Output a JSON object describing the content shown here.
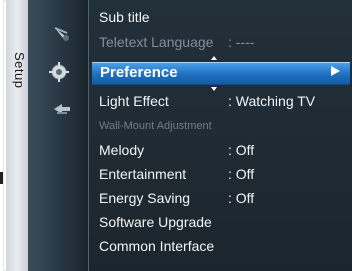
{
  "sidebar": {
    "category_label": "Setup",
    "icons": [
      "antenna-icon",
      "gear-icon",
      "input-icon"
    ]
  },
  "menu": {
    "items": [
      {
        "label": "Sub title",
        "value": ""
      },
      {
        "label": "Teletext Language",
        "value": ": ----"
      },
      {
        "label": "Preference",
        "value": ""
      },
      {
        "label": "Light Effect",
        "value": ": Watching TV"
      },
      {
        "label": "Wall-Mount Adjustment",
        "value": ""
      },
      {
        "label": "Melody",
        "value": ": Off"
      },
      {
        "label": "Entertainment",
        "value": ": Off"
      },
      {
        "label": "Energy Saving",
        "value": ": Off"
      },
      {
        "label": "Software Upgrade",
        "value": ""
      },
      {
        "label": "Common Interface",
        "value": ""
      }
    ],
    "selected_index": 2,
    "submenu_arrow": "right-arrow-icon"
  },
  "colors": {
    "highlight": "#1f6fc0",
    "panel_bg": "#1f2a33",
    "text": "#f2f5f7",
    "disabled_text": "#7f8e98"
  }
}
